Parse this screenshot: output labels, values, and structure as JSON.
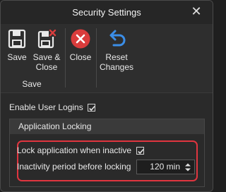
{
  "window": {
    "title": "Security Settings"
  },
  "ribbon": {
    "save_label": "Save",
    "save_close_label": "Save &\nClose",
    "close_label": "Close",
    "reset_label": "Reset\nChanges",
    "group_label": "Save"
  },
  "settings": {
    "enable_user_logins": {
      "label": "Enable User Logins",
      "checked": true
    },
    "group_header": "Application Locking",
    "lock_when_inactive": {
      "label": "Lock application when inactive",
      "checked": true
    },
    "inactivity_period": {
      "label": "Inactivity period before locking",
      "value": "120 min"
    }
  },
  "colors": {
    "highlight": "#e0353f",
    "close_icon": "#d93c3c",
    "reset_icon": "#3b8ee8"
  }
}
